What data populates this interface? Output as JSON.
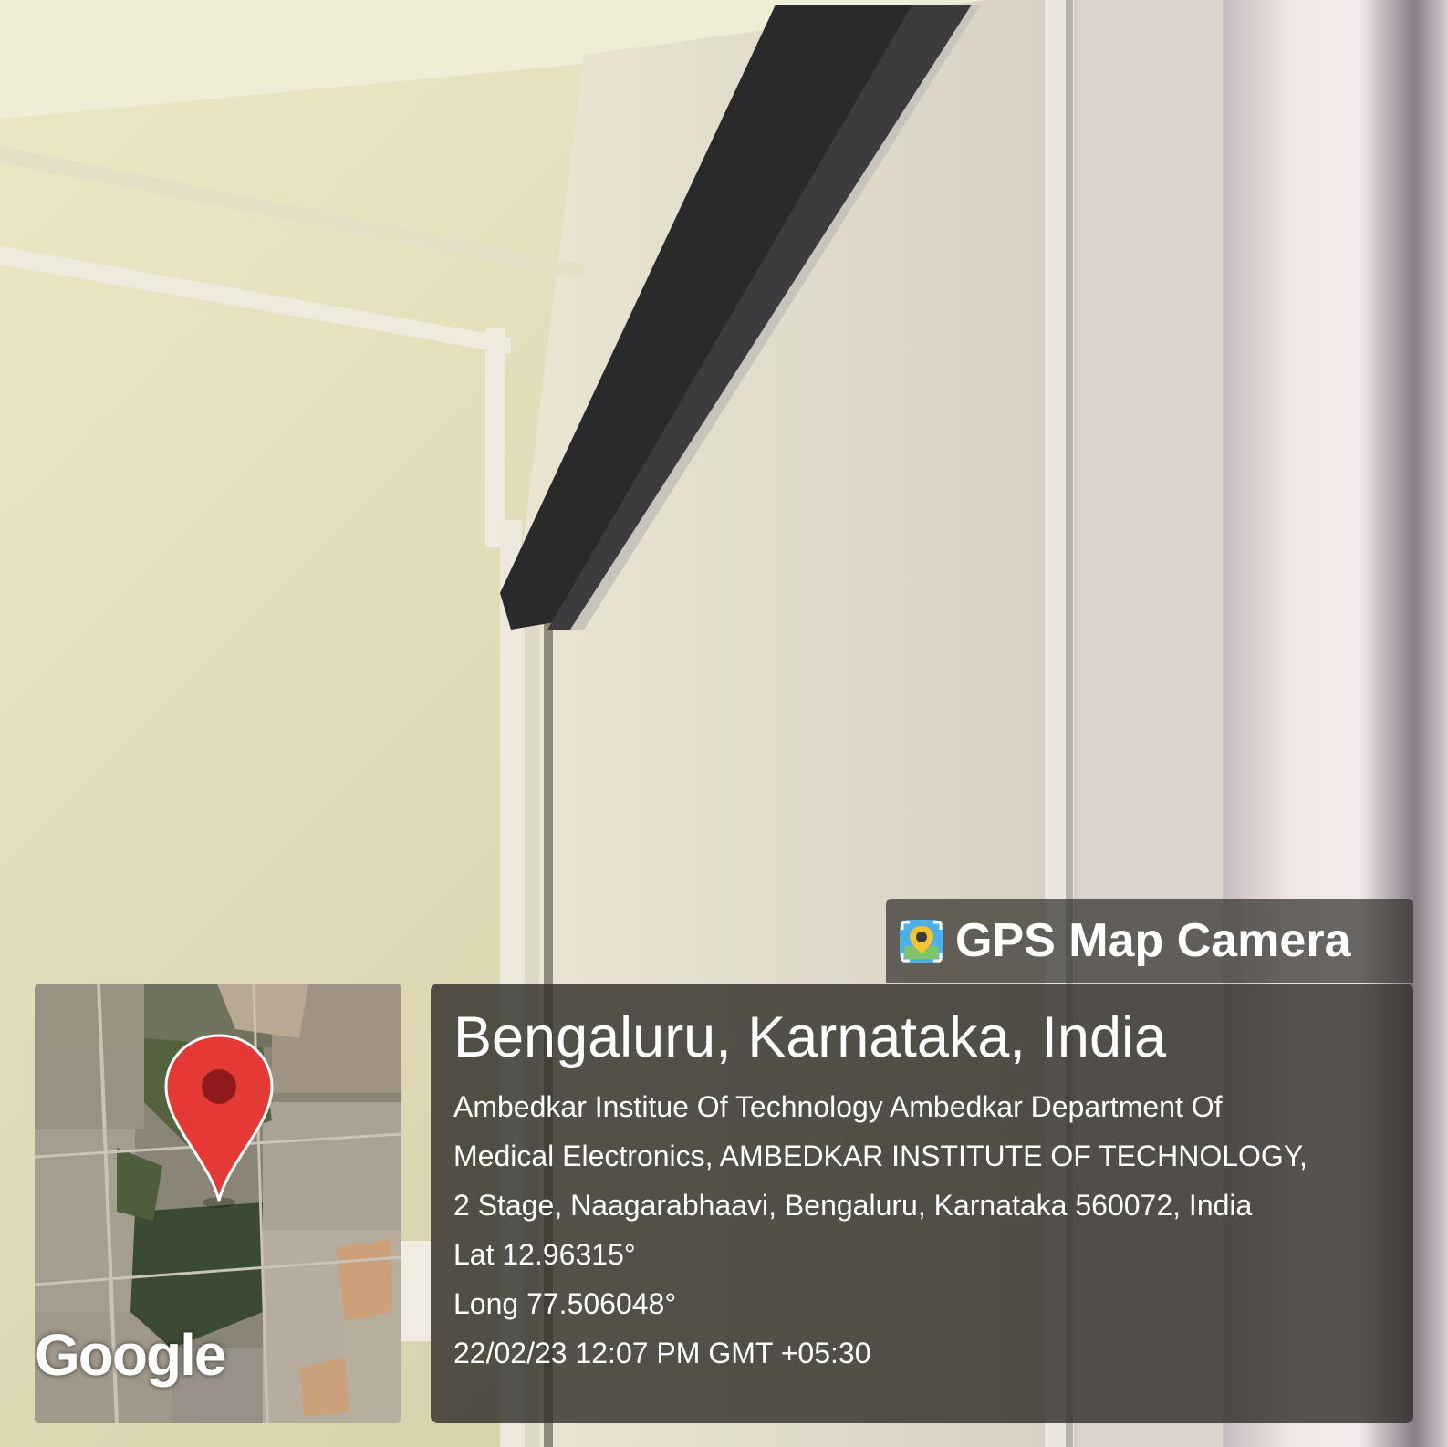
{
  "badge": {
    "icon": "gps-map-camera-icon",
    "label": "GPS Map Camera"
  },
  "location": {
    "title": "Bengaluru, Karnataka, India",
    "address_lines": [
      "Ambedkar Institue Of Technology Ambedkar Department Of",
      "Medical Electronics, AMBEDKAR INSTITUTE OF TECHNOLOGY,",
      "2 Stage, Naagarabhaavi, Bengaluru, Karnataka 560072, India"
    ],
    "lat": "Lat 12.96315°",
    "long": "Long 77.506048°",
    "datetime": "22/02/23 12:07 PM GMT +05:30"
  },
  "map": {
    "provider_logo": "Google",
    "marker_icon": "location-pin-icon",
    "marker_color": "#e53935"
  }
}
